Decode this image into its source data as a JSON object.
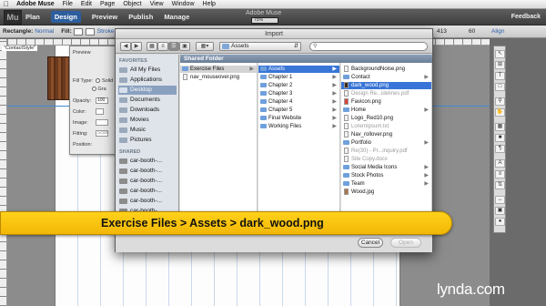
{
  "menubar": {
    "apple": "",
    "items": [
      "Adobe Muse",
      "File",
      "Edit",
      "Page",
      "Object",
      "View",
      "Window",
      "Help"
    ]
  },
  "modebar": {
    "logo": "Mu",
    "modes": [
      "Plan",
      "Design",
      "Preview",
      "Publish",
      "Manage"
    ],
    "active_mode": "Design",
    "app_title": "Adobe Muse",
    "feedback": "Feedback",
    "zoom": "75%"
  },
  "ctrlbar": {
    "rect_label": "Rectangle:",
    "rect_value": "Normal",
    "fill_label": "Fill:",
    "stroke_label": "Stroke",
    "width_value": "413",
    "height_value": "60",
    "align_label": "Align"
  },
  "canvas": {
    "context_tag": "\"ContactStyle\""
  },
  "panel": {
    "preview_label": "Preview",
    "fill_type_label": "Fill Type:",
    "fill_type_opt1": "Solid",
    "fill_type_opt2": "Gra",
    "opacity_label": "Opacity:",
    "opacity_value": "100",
    "color_label": "Color:",
    "image_label": "Image:",
    "fitting_label": "Fitting:",
    "fitting_value": "Scale",
    "position_label": "Position:"
  },
  "dialog": {
    "title": "Import",
    "location": "Assets",
    "search_placeholder": "",
    "sidebar": {
      "favorites_header": "FAVORITES",
      "favorites": [
        "All My Files",
        "Applications",
        "Desktop",
        "Documents",
        "Downloads",
        "Movies",
        "Music",
        "Pictures"
      ],
      "selected_favorite": "Desktop",
      "shared_header": "SHARED",
      "shared": [
        "car-booth-...",
        "car-booth-...",
        "car-booth-...",
        "car-booth-...",
        "car-booth-...",
        "car-booth-..."
      ]
    },
    "shared_folder_label": "Shared Folder",
    "column1": [
      "Exercise Files",
      "nav_mouseover.png"
    ],
    "column1_selected": "Exercise Files",
    "column2": [
      "Assets",
      "Chapter 1",
      "Chapter 2",
      "Chapter 3",
      "Chapter 4",
      "Chapter 5",
      "Final Website",
      "Working Files"
    ],
    "column2_selected": "Assets",
    "column3": [
      {
        "name": "BackgroundNoise.png",
        "kind": "file",
        "dim": false
      },
      {
        "name": "Contact",
        "kind": "folder",
        "dim": false
      },
      {
        "name": "dark_wood.png",
        "kind": "file",
        "dim": false
      },
      {
        "name": "Design Re...idelines.pdf",
        "kind": "file",
        "dim": true
      },
      {
        "name": "Favicon.png",
        "kind": "file",
        "dim": false
      },
      {
        "name": "Home",
        "kind": "folder",
        "dim": false
      },
      {
        "name": "Logo_Red10.png",
        "kind": "file",
        "dim": false
      },
      {
        "name": "LoremIpsum.txt",
        "kind": "file",
        "dim": true
      },
      {
        "name": "Nav_rollover.png",
        "kind": "file",
        "dim": false
      },
      {
        "name": "Portfolio",
        "kind": "folder",
        "dim": false
      },
      {
        "name": "Re(30) - Pr...inquiry.pdf",
        "kind": "file",
        "dim": true
      },
      {
        "name": "Site Copy.docx",
        "kind": "file",
        "dim": true
      },
      {
        "name": "Social Media Icons",
        "kind": "folder",
        "dim": false
      },
      {
        "name": "Stock Photos",
        "kind": "folder",
        "dim": false
      },
      {
        "name": "Team",
        "kind": "folder",
        "dim": false
      },
      {
        "name": "Wood.jpg",
        "kind": "file",
        "dim": false
      }
    ],
    "column3_selected": "dark_wood.png",
    "cancel_label": "Cancel",
    "open_label": "Open"
  },
  "caption": "Exercise Files > Assets > dark_wood.png",
  "watermark": "lynda.com",
  "colors": {
    "caption_bg": "#f5be0b",
    "selection": "#3875d7",
    "active_mode": "#2d5e9e"
  }
}
